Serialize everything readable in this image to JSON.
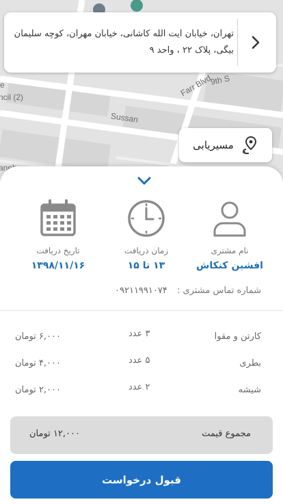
{
  "address": {
    "text": "تهران، خیابان ایت الله کاشانی، خیابان مهران، کوچه سلیمان بیگی، پلاک ۲۲ ، واحد ۹"
  },
  "map": {
    "labels": [
      "ncil (2)",
      "Sussan",
      "Farr Blvd",
      "9th S",
      "e",
      "aneh"
    ]
  },
  "route_button": {
    "label": "مسیریابی",
    "icon": "route-pin-icon"
  },
  "customer": {
    "label": "نام مشتری",
    "value": "افشین کنکاش",
    "icon": "user-icon"
  },
  "pickup_time": {
    "label": "زمان دریافت",
    "value": "۱۳ تا ۱۵",
    "icon": "clock-icon"
  },
  "pickup_date": {
    "label": "تاریخ دریافت",
    "value": "۱۳۹۸/۱۱/۱۶",
    "icon": "calendar-icon"
  },
  "phone": {
    "label": "شماره تماس مشتری :",
    "value": "۰۹۲۱۱۹۹۱۰۷۴"
  },
  "items": [
    {
      "name": "کارتن و مقوا",
      "qty": "۳ عدد",
      "price": "۶,۰۰۰ تومان"
    },
    {
      "name": "بطری",
      "qty": "۵ عدد",
      "price": "۴,۰۰۰ تومان"
    },
    {
      "name": "شیشه",
      "qty": "۲ عدد",
      "price": "۲,۰۰۰ تومان"
    }
  ],
  "total": {
    "label": "مجموع قیمت",
    "value": "۱۲,۰۰۰ تومان"
  },
  "accept_button": {
    "label": "قبول درخواست"
  },
  "colors": {
    "accent": "#1e6fc3",
    "value_text": "#1f6fb5",
    "icon_gray": "#8a8a8a"
  }
}
